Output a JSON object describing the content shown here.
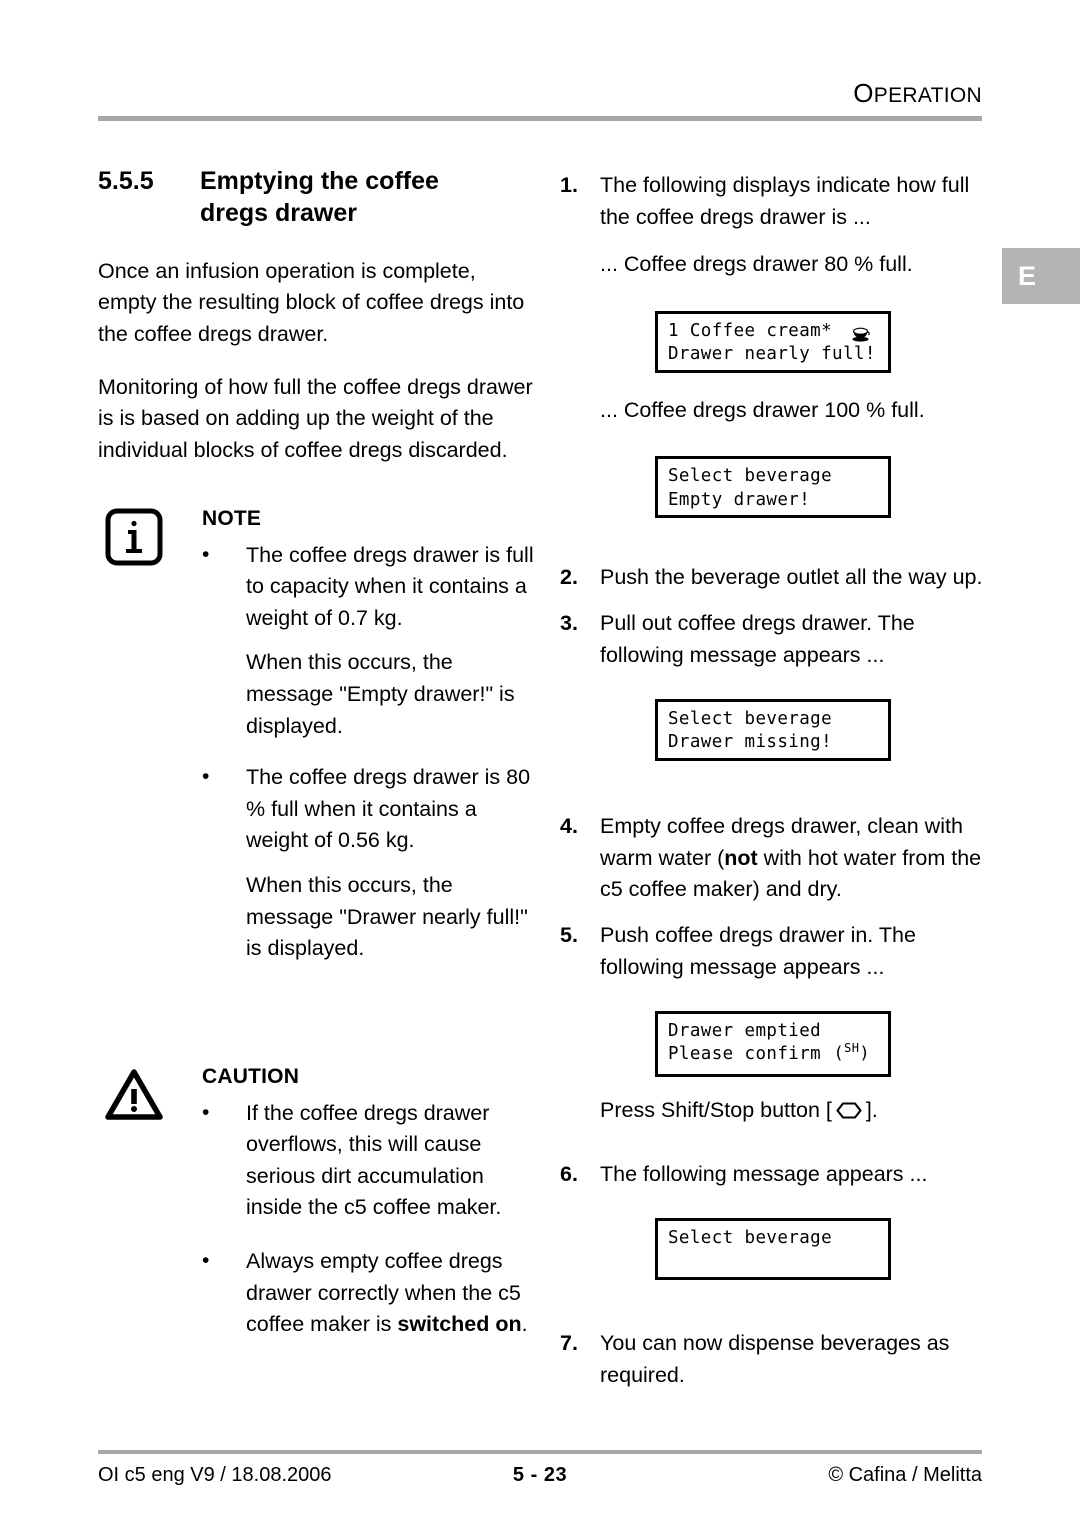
{
  "header": {
    "title_first": "O",
    "title_rest": "PERATION"
  },
  "edge_tab": {
    "label": "E"
  },
  "left_column": {
    "section_number": "5.5.5",
    "section_title_line1": "Emptying the coffee",
    "section_title_line2": "dregs drawer",
    "paragraphs": [
      "Once an infusion operation is complete, empty the resulting block of coffee dregs into the coffee dregs drawer.",
      "Monitoring of how full the coffee dregs drawer is is based on adding up the weight of the individual blocks of coffee dregs discarded."
    ],
    "note": {
      "icon": "info-icon",
      "title": "NOTE",
      "bullets": [
        {
          "mark": "•",
          "text": "The coffee dregs drawer is full to capacity when it contains a weight of 0.7 kg.",
          "follow_up": "When this occurs, the message \"Empty drawer!\" is displayed."
        },
        {
          "mark": "•",
          "text": "The coffee dregs drawer is 80 % full when it contains a weight of 0.56 kg.",
          "follow_up": "When this occurs, the message \"Drawer nearly full!\" is displayed."
        }
      ]
    },
    "caution": {
      "icon": "warning-triangle-icon",
      "title": "CAUTION",
      "bullets": [
        {
          "mark": "•",
          "text_plain": "If the coffee dregs drawer overflows, this will cause serious dirt accumulation inside the c5 coffee maker."
        },
        {
          "mark": "•",
          "text_pre": "Always empty coffee dregs drawer correctly when the c5 coffee maker is ",
          "text_bold": "switched on",
          "text_post": "."
        }
      ]
    }
  },
  "right_column": {
    "steps": [
      {
        "num": "1.",
        "text": "The following displays indicate how full the coffee dregs drawer is ..."
      },
      {
        "num": "2.",
        "text": "Push the beverage outlet all the way up."
      },
      {
        "num": "3.",
        "text": "Pull out coffee dregs drawer. The following message appears ..."
      },
      {
        "num": "4.",
        "text_pre": "Empty coffee dregs drawer, clean with warm water (",
        "text_bold": "not",
        "text_post": " with hot water from the c5 coffee maker) and dry."
      },
      {
        "num": "5.",
        "text": "Push coffee dregs drawer in. The following message appears ..."
      },
      {
        "num": "6.",
        "text": "The following message appears ..."
      },
      {
        "num": "7.",
        "text": "You can now dispense beverages as required."
      }
    ],
    "caption_80": "... Coffee dregs drawer 80 % full.",
    "caption_100": "... Coffee dregs drawer 100 % full.",
    "press_shift_pre": "Press Shift/Stop button [",
    "press_shift_post": "].",
    "displays": [
      {
        "id": "display-nearly-full",
        "line1": "1 Coffee cream*",
        "line2": "Drawer nearly full!",
        "icon": "coffee-cup-icon"
      },
      {
        "id": "display-empty-drawer",
        "line1": "Select beverage",
        "line2": "Empty drawer!",
        "icon": ""
      },
      {
        "id": "display-drawer-missing",
        "line1": "Select beverage",
        "line2": "Drawer missing!",
        "icon": ""
      },
      {
        "id": "display-drawer-emptied",
        "line1": "Drawer emptied",
        "line2": "Please confirm",
        "icon": "sh-button-symbol",
        "icon_label": "SH"
      },
      {
        "id": "display-select-beverage",
        "line1": "Select beverage",
        "line2": "",
        "icon": ""
      }
    ]
  },
  "footer": {
    "left": "OI c5 eng V9 / 18.08.2006",
    "center": "5 - 23",
    "right": "© Cafina / Melitta"
  },
  "colors": {
    "rule": "#a8a8a8",
    "tab_bg": "#b4b4b4",
    "text": "#000000"
  }
}
